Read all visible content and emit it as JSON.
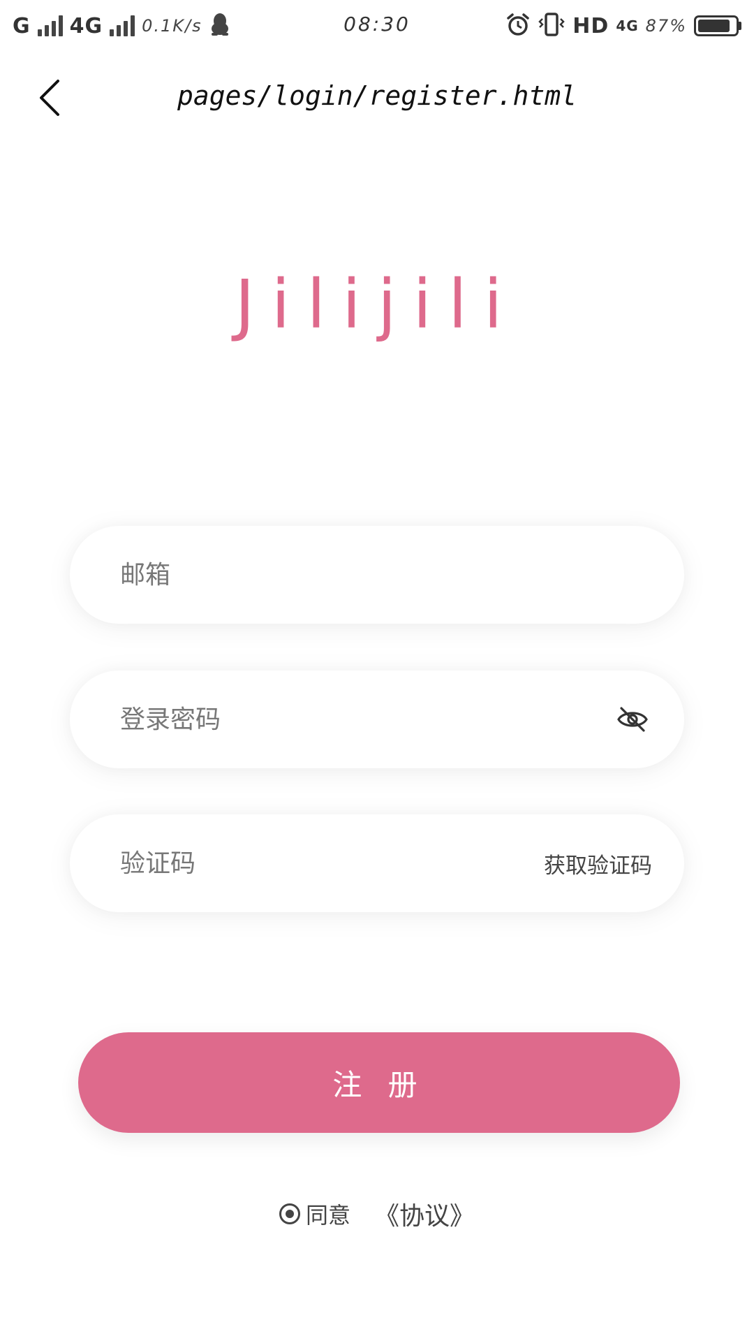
{
  "status_bar": {
    "signal_1": "G",
    "signal_2": "4G",
    "net_speed": "0.1K/s",
    "time": "08:30",
    "hd": "HD",
    "network": "4G",
    "battery": "87%",
    "battery_level": 0.87,
    "icons": [
      "qq-penguin-icon",
      "alarm-icon",
      "vibrate-icon"
    ]
  },
  "nav": {
    "back_icon": "chevron-left-icon",
    "title": "pages/login/register.html"
  },
  "logo": {
    "text": "Jilijili"
  },
  "form": {
    "email_placeholder": "邮箱",
    "email_value": "",
    "password_placeholder": "登录密码",
    "password_value": "",
    "password_toggle_icon": "eye-off-icon",
    "code_placeholder": "验证码",
    "code_value": "",
    "get_code_label": "获取验证码"
  },
  "register": {
    "label": "注 册"
  },
  "agreement": {
    "agree_label": "同意",
    "protocol_label": "《协议》"
  },
  "colors": {
    "accent": "#de6a8c",
    "background": "#ffffff",
    "text": "#333333"
  }
}
